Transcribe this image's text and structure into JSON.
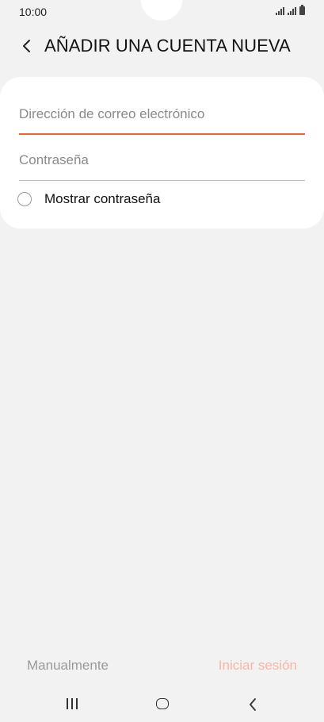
{
  "status_bar": {
    "time": "10:00",
    "icons": [
      "signal-icon",
      "signal-icon",
      "battery-icon"
    ]
  },
  "header": {
    "title": "AÑADIR UNA CUENTA NUEVA",
    "back_icon": "chevron-left-icon"
  },
  "form": {
    "email": {
      "placeholder": "Dirección de correo electrónico",
      "value": ""
    },
    "password": {
      "placeholder": "Contraseña",
      "value": ""
    },
    "show_password": {
      "label": "Mostrar contraseña",
      "checked": false
    }
  },
  "actions": {
    "manual_label": "Manualmente",
    "login_label": "Iniciar sesión"
  },
  "colors": {
    "accent": "#f0602c",
    "disabled_accent": "#f7b7a1",
    "background": "#f2f2f2",
    "card": "#ffffff"
  },
  "nav_bar": {
    "icons": [
      "recent-apps-icon",
      "home-icon",
      "back-icon"
    ]
  }
}
